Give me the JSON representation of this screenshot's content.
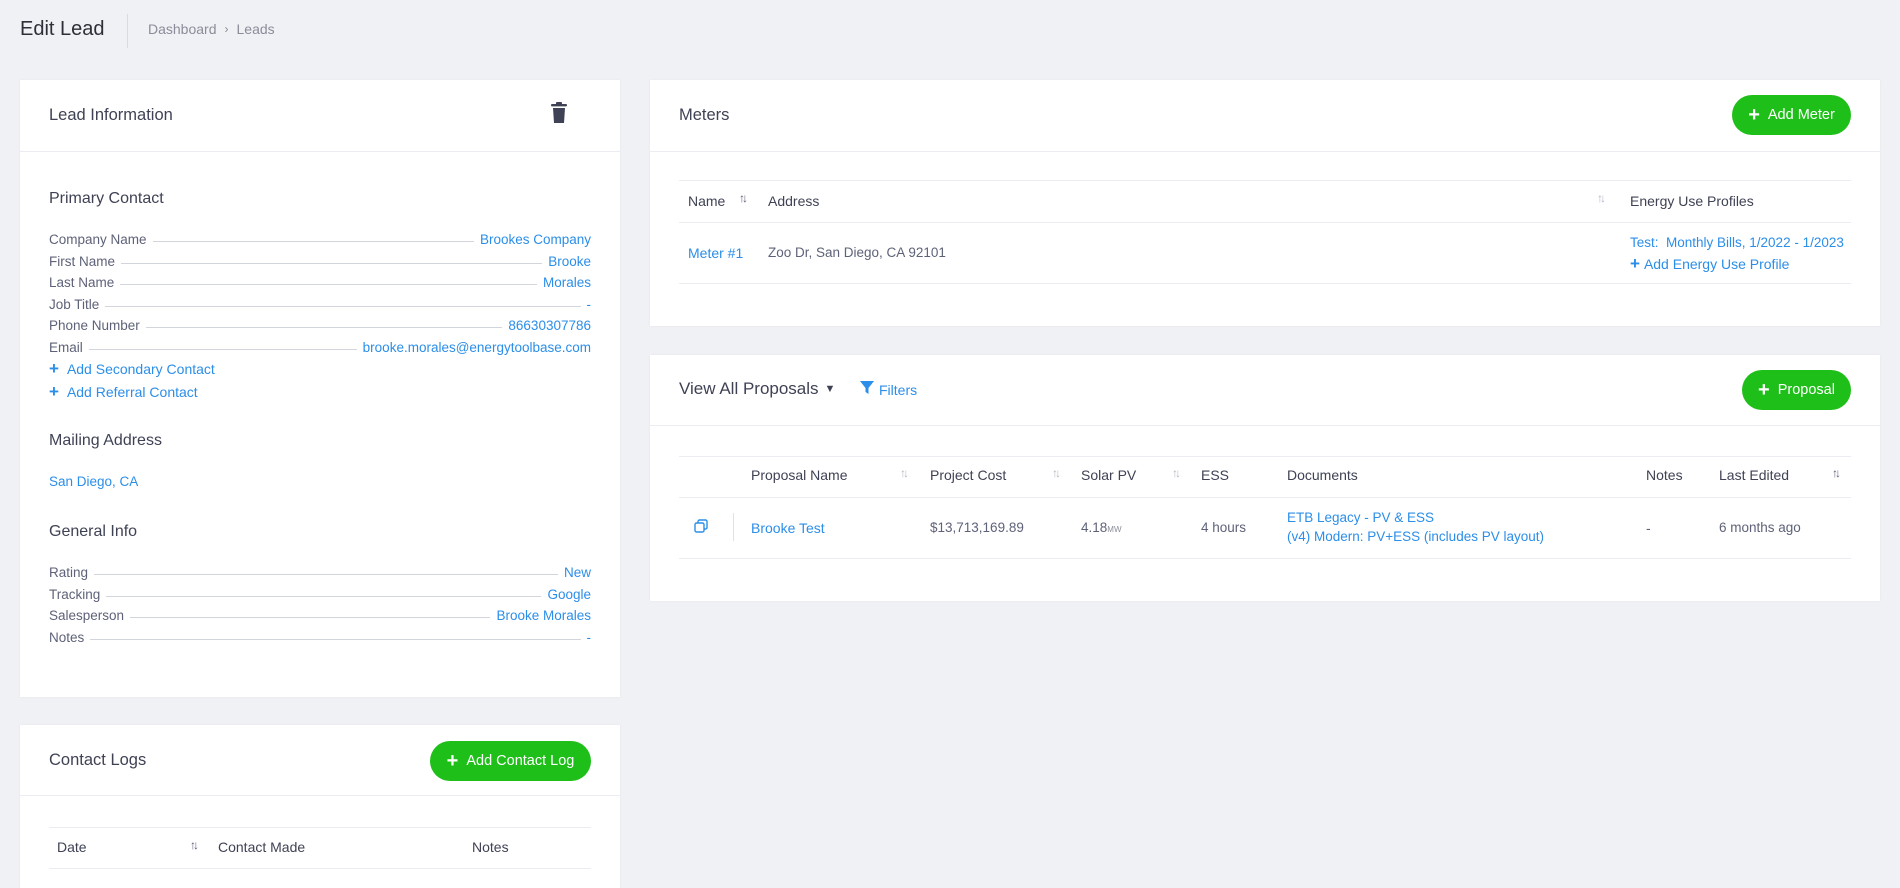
{
  "page": {
    "title": "Edit Lead"
  },
  "breadcrumb": {
    "items": [
      "Dashboard",
      "Leads"
    ]
  },
  "lead_info": {
    "title": "Lead Information",
    "trash_icon": "trash-icon",
    "primary_contact": {
      "title": "Primary Contact",
      "fields": [
        {
          "label": "Company Name",
          "value": "Brookes Company"
        },
        {
          "label": "First Name",
          "value": "Brooke"
        },
        {
          "label": "Last Name",
          "value": "Morales"
        },
        {
          "label": "Job Title",
          "value": "-"
        },
        {
          "label": "Phone Number",
          "value": "86630307786"
        },
        {
          "label": "Email",
          "value": "brooke.morales@energytoolbase.com"
        }
      ],
      "add_secondary": "Add Secondary Contact",
      "add_referral": "Add Referral Contact"
    },
    "mailing_address": {
      "title": "Mailing Address",
      "value": "San Diego, CA"
    },
    "general_info": {
      "title": "General Info",
      "fields": [
        {
          "label": "Rating",
          "value": "New"
        },
        {
          "label": "Tracking",
          "value": "Google"
        },
        {
          "label": "Salesperson",
          "value": "Brooke Morales"
        },
        {
          "label": "Notes",
          "value": "-"
        }
      ]
    }
  },
  "contact_logs": {
    "title": "Contact Logs",
    "add_button": "Add Contact Log",
    "columns": [
      "Date",
      "Contact Made",
      "Notes"
    ]
  },
  "meters": {
    "title": "Meters",
    "add_button": "Add Meter",
    "columns": [
      "Name",
      "Address",
      "Energy Use Profiles"
    ],
    "rows": [
      {
        "name": "Meter #1",
        "address": "Zoo Dr, San Diego, CA 92101",
        "profile": "Test:  Monthly Bills, 1/2022 - 1/2023",
        "add_profile": "Add Energy Use Profile"
      }
    ]
  },
  "proposals": {
    "view_label": "View All Proposals",
    "filters_label": "Filters",
    "add_button": "Proposal",
    "columns": [
      "Proposal Name",
      "Project Cost",
      "Solar PV",
      "ESS",
      "Documents",
      "Notes",
      "Last Edited"
    ],
    "rows": [
      {
        "name": "Brooke Test",
        "cost": "$13,713,169.89",
        "solar_value": "4.18",
        "solar_unit": "MW",
        "ess": "4 hours",
        "doc1": "ETB Legacy - PV & ESS",
        "doc2": "(v4) Modern: PV+ESS (includes PV layout)",
        "notes": "-",
        "last_edited": "6 months ago"
      }
    ]
  },
  "colors": {
    "accent": "#1fbf1a",
    "link": "#2b8ee8",
    "background": "#f0f1f5"
  }
}
